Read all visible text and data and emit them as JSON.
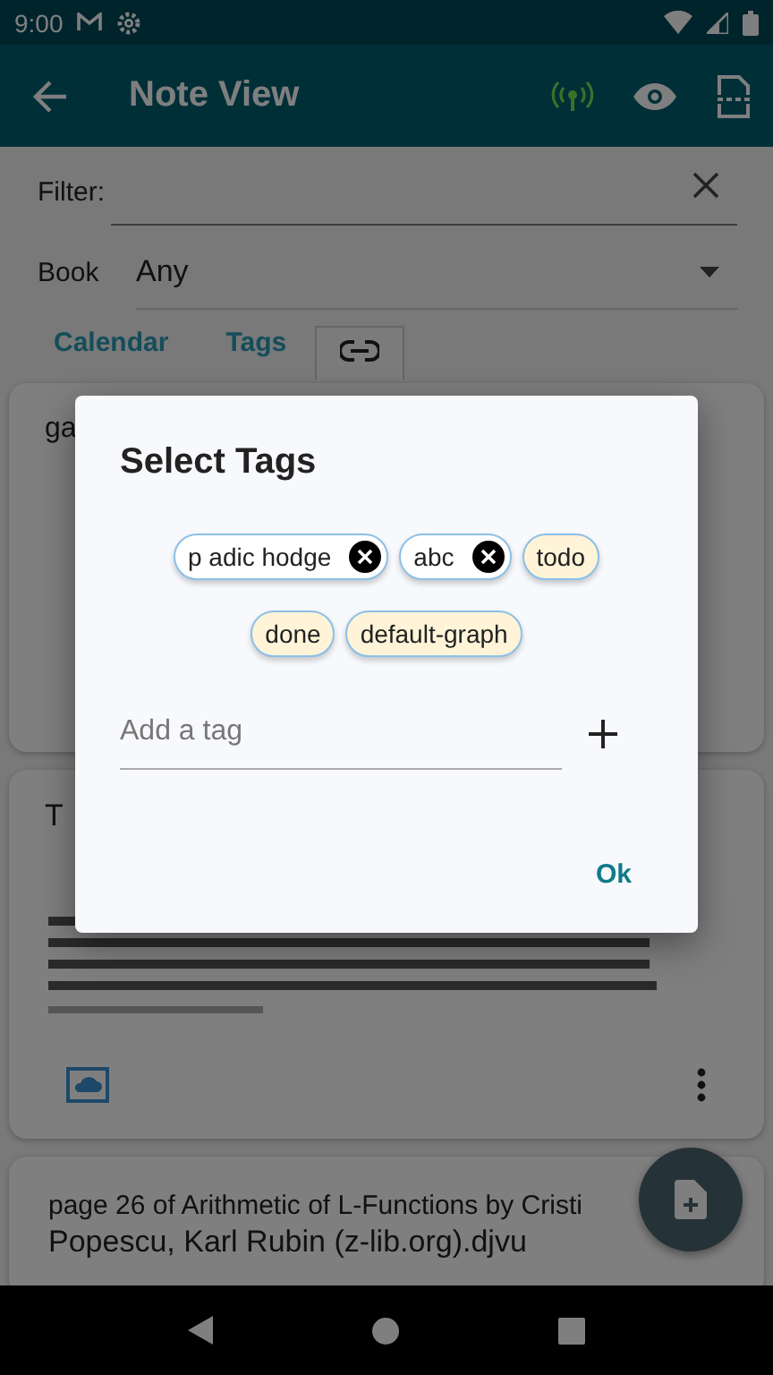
{
  "status_bar": {
    "time": "9:00"
  },
  "app_bar": {
    "title": "Note View"
  },
  "filter": {
    "label": "Filter:"
  },
  "book": {
    "label": "Book",
    "value": "Any"
  },
  "tabs": [
    {
      "kind": "text",
      "label": "Calendar",
      "selected": false
    },
    {
      "kind": "text",
      "label": "Tags",
      "selected": false
    },
    {
      "kind": "link",
      "selected": true
    }
  ],
  "cards": [
    {
      "kind": "plain",
      "title_lines": [
        "ga"
      ]
    },
    {
      "kind": "picture",
      "title_lines": [
        "T"
      ]
    },
    {
      "kind": "plain",
      "title_lines": [
        "page 26 of Arithmetic of L-Functions by Cristi",
        "Popescu, Karl Rubin (z-lib.org).djvu"
      ]
    }
  ],
  "dialog": {
    "title": "Select Tags",
    "tags": [
      {
        "label": "p adic hodge",
        "selected": true
      },
      {
        "label": "abc",
        "selected": true
      },
      {
        "label": "todo",
        "selected": false
      },
      {
        "label": "done",
        "selected": false
      },
      {
        "label": "default-graph",
        "selected": false
      }
    ],
    "input": {
      "placeholder": "Add a tag"
    },
    "button": "Ok"
  }
}
